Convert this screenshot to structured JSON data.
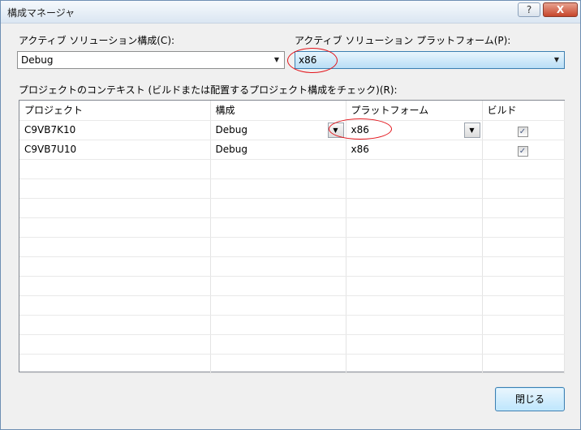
{
  "window": {
    "title": "構成マネージャ",
    "help_label": "?",
    "close_label": "X"
  },
  "solution": {
    "config_label": "アクティブ ソリューション構成(C):",
    "config_value": "Debug",
    "platform_label": "アクティブ ソリューション プラットフォーム(P):",
    "platform_value": "x86"
  },
  "context_label": "プロジェクトのコンテキスト (ビルドまたは配置するプロジェクト構成をチェック)(R):",
  "table": {
    "headers": [
      "プロジェクト",
      "構成",
      "プラットフォーム",
      "ビルド"
    ],
    "rows": [
      {
        "project": "C9VB7K10",
        "config": "Debug",
        "platform": "x86",
        "build": "✓"
      },
      {
        "project": "C9VB7U10",
        "config": "Debug",
        "platform": "x86",
        "build": "✓"
      }
    ]
  },
  "close_button": "閉じる",
  "icons": {
    "dropdown": "▼",
    "checkbox": "✓"
  }
}
